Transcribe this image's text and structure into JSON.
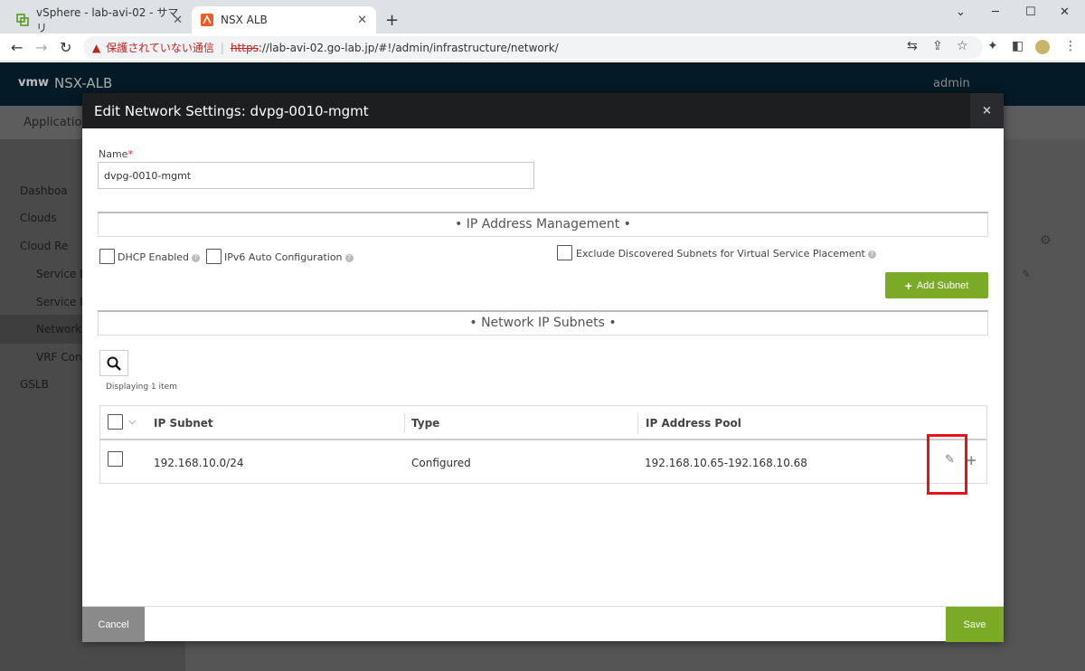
{
  "browser": {
    "tabs": [
      {
        "title": "vSphere - lab-avi-02 - サマリ"
      },
      {
        "title": "NSX ALB"
      }
    ],
    "address": {
      "warning": "保護されていない通信",
      "separator": "|",
      "scheme": "https",
      "rest": "://lab-avi-02.go-lab.jp/#!/admin/infrastructure/network/"
    },
    "window_controls": {
      "minimize": "─",
      "maximize": "☐",
      "close": "✕",
      "tab_search": "⌄"
    }
  },
  "app": {
    "logo": "vmw",
    "title": "NSX-ALB",
    "user": "admin",
    "subnav_first": "Applicatio",
    "sidebar": [
      {
        "label": "Dashboa"
      },
      {
        "label": "Clouds"
      },
      {
        "label": "Cloud Re"
      },
      {
        "label": "Service E"
      },
      {
        "label": "Service E"
      },
      {
        "label": "Network"
      },
      {
        "label": "VRF Con"
      },
      {
        "label": "GSLB"
      }
    ]
  },
  "modal": {
    "title": "Edit Network Settings: dvpg-0010-mgmt",
    "close": "×",
    "name_label": "Name",
    "required_mark": "*",
    "name_value": "dvpg-0010-mgmt",
    "ipam_section": "• IP Address Management •",
    "dhcp_label": "DHCP Enabled",
    "ipv6_label": "IPv6 Auto Configuration",
    "exclude_label": "Exclude Discovered Subnets for Virtual Service Placement",
    "help_glyph": "?",
    "add_subnet": "Add Subnet",
    "add_plus": "+",
    "subnets_section": "• Network IP Subnets •",
    "displaying": "Displaying 1 item",
    "columns": [
      "IP Subnet",
      "Type",
      "IP Address Pool"
    ],
    "rows": [
      {
        "subnet": "192.168.10.0/24",
        "type": "Configured",
        "pool": "192.168.10.65-192.168.10.68"
      }
    ],
    "row_plus": "+",
    "cancel": "Cancel",
    "save": "Save"
  },
  "colors": {
    "accent_green": "#7aaa26",
    "highlight_red": "#e8111c",
    "modal_header": "#1d1e20"
  },
  "icons": [
    "vsphere-favicon",
    "nsx-favicon",
    "back-icon",
    "forward-icon",
    "reload-icon",
    "warning-icon",
    "translate-icon",
    "share-icon",
    "star-icon",
    "extensions-icon",
    "sidepanel-icon",
    "profile-icon",
    "menu-icon",
    "search-icon",
    "pencil-icon",
    "gear-icon"
  ]
}
